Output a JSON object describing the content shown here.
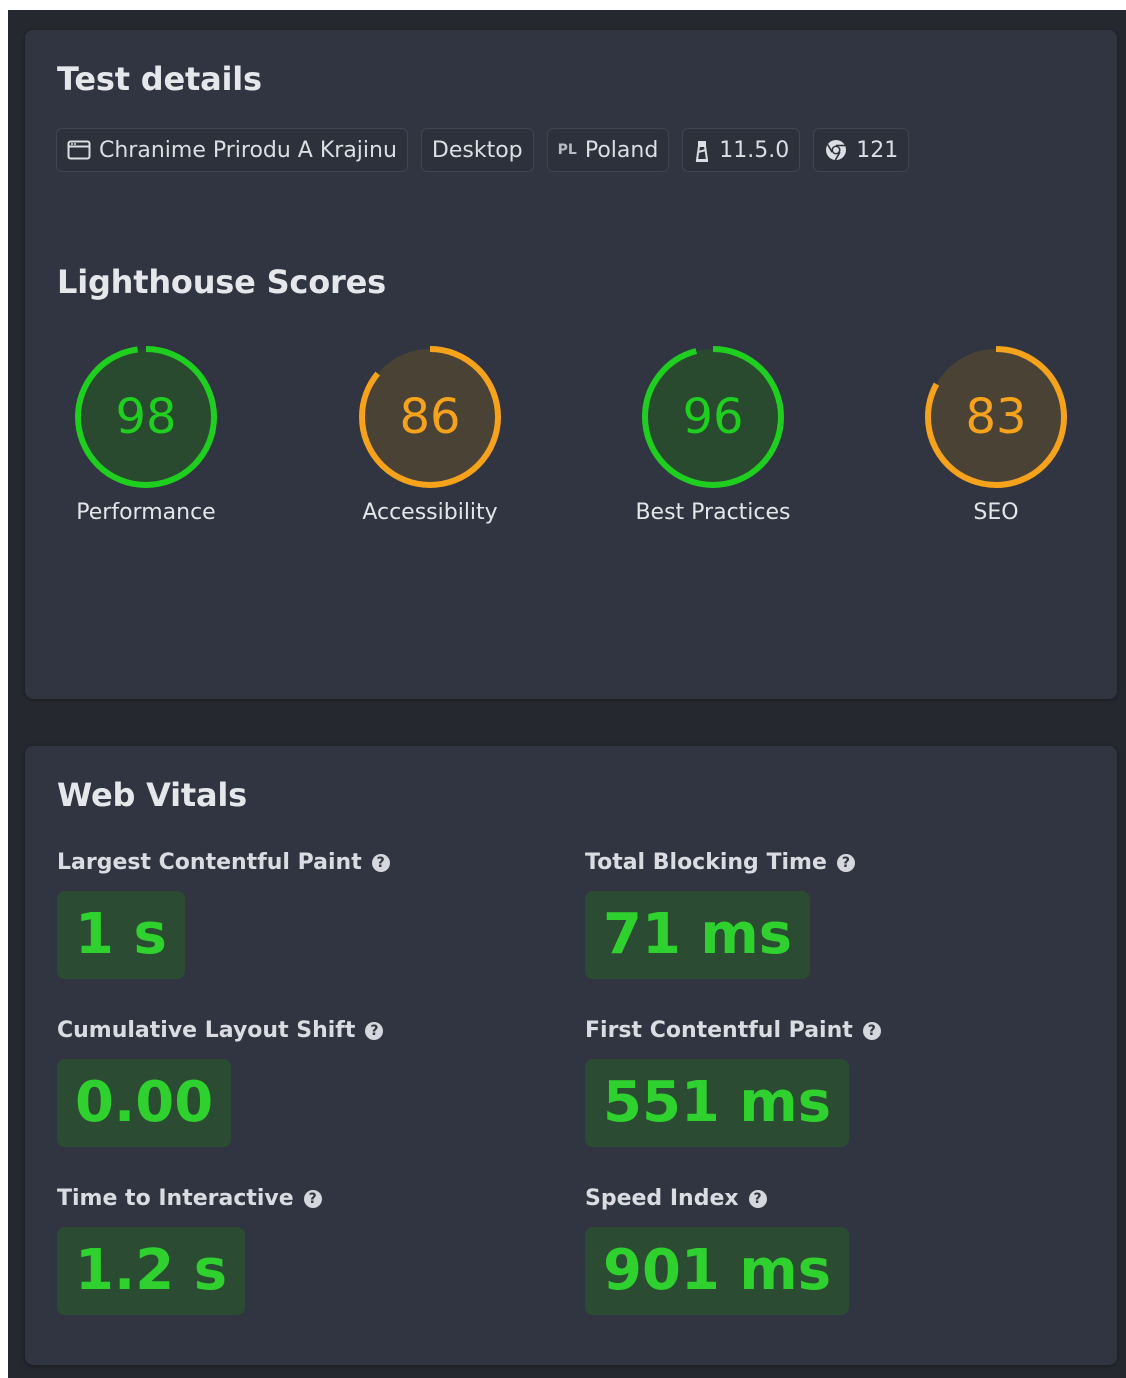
{
  "test_details": {
    "title": "Test details",
    "site_name": "Chranime Prirodu A Krajinu",
    "device": "Desktop",
    "country_code": "PL",
    "country": "Poland",
    "lighthouse_version": "11.5.0",
    "chrome_version": "121"
  },
  "lighthouse": {
    "title": "Lighthouse Scores",
    "scores": [
      {
        "label": "Performance",
        "value": "98",
        "fraction": 0.98,
        "status": "good",
        "color": "#1fcf1f"
      },
      {
        "label": "Accessibility",
        "value": "86",
        "fraction": 0.86,
        "status": "average",
        "color": "#f7a21b"
      },
      {
        "label": "Best Practices",
        "value": "96",
        "fraction": 0.96,
        "status": "good",
        "color": "#1fcf1f"
      },
      {
        "label": "SEO",
        "value": "83",
        "fraction": 0.83,
        "status": "average",
        "color": "#f7a21b"
      }
    ]
  },
  "web_vitals": {
    "title": "Web Vitals",
    "items": [
      {
        "label": "Largest Contentful Paint",
        "value": "1 s"
      },
      {
        "label": "Total Blocking Time",
        "value": "71 ms"
      },
      {
        "label": "Cumulative Layout Shift",
        "value": "0.00"
      },
      {
        "label": "First Contentful Paint",
        "value": "551 ms"
      },
      {
        "label": "Time to Interactive",
        "value": "1.2 s"
      },
      {
        "label": "Speed Index",
        "value": "901 ms"
      }
    ],
    "help_glyph": "?",
    "good_color": "#2fd12f"
  },
  "icons": {
    "site": "browser-window-icon",
    "lighthouse": "lighthouse-icon",
    "chrome": "chrome-icon",
    "help": "help-circle-icon"
  }
}
